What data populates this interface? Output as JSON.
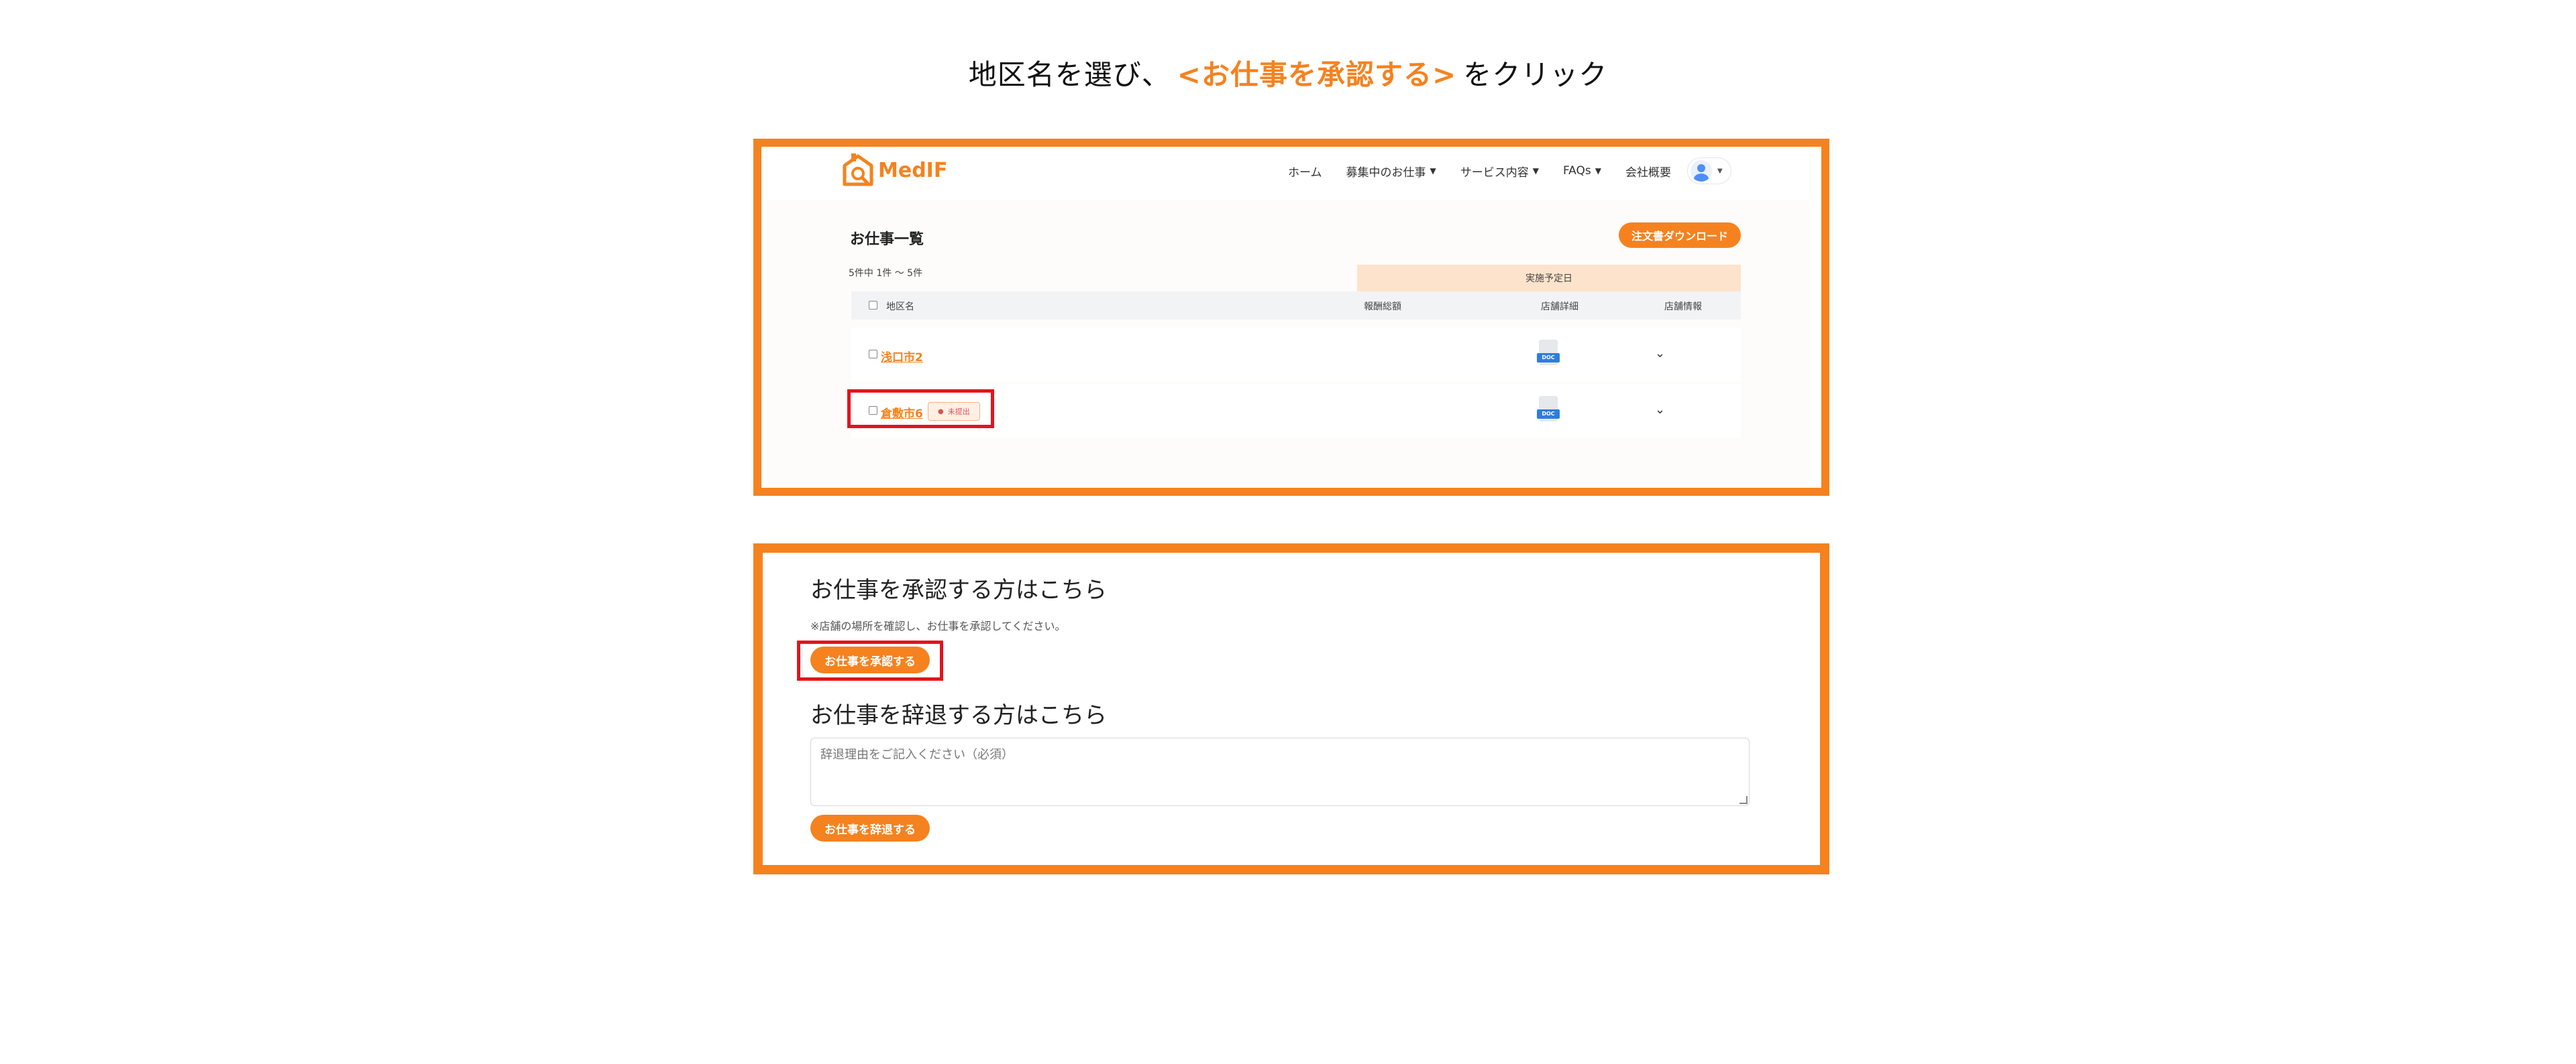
{
  "instruction": {
    "prefix": "地区名を選び、",
    "highlight": "<お仕事を承認する>",
    "suffix": "をクリック"
  },
  "app": {
    "brand": "MedIF",
    "nav": [
      {
        "label": "ホーム",
        "dropdown": false
      },
      {
        "label": "募集中のお仕事",
        "dropdown": true
      },
      {
        "label": "サービス内容",
        "dropdown": true
      },
      {
        "label": "FAQs",
        "dropdown": true
      },
      {
        "label": "会社概要",
        "dropdown": false
      }
    ]
  },
  "jobs": {
    "title": "お仕事一覧",
    "download_label": "注文書ダウンロード",
    "count": "5件中 1件 〜 5件",
    "group_header": "実施予定日",
    "columns": [
      "地区名",
      "報酬総額",
      "店舗詳細",
      "店舗情報"
    ],
    "rows": [
      {
        "name": "浅口市2",
        "badge": "",
        "doc": "DOC"
      },
      {
        "name": "倉敷市6",
        "badge": "未提出",
        "doc": "DOC"
      }
    ]
  },
  "approve": {
    "title": "お仕事を承認する方はこちら",
    "note": "※店舗の場所を確認し、お仕事を承認してください。",
    "button": "お仕事を承認する"
  },
  "decline": {
    "title": "お仕事を辞退する方はこちら",
    "placeholder": "辞退理由をご記入ください（必須）",
    "button": "お仕事を辞退する"
  },
  "colors": {
    "accent": "#f5821f",
    "highlight_box": "#e3141b",
    "group_header_bg": "#fde3cb"
  }
}
